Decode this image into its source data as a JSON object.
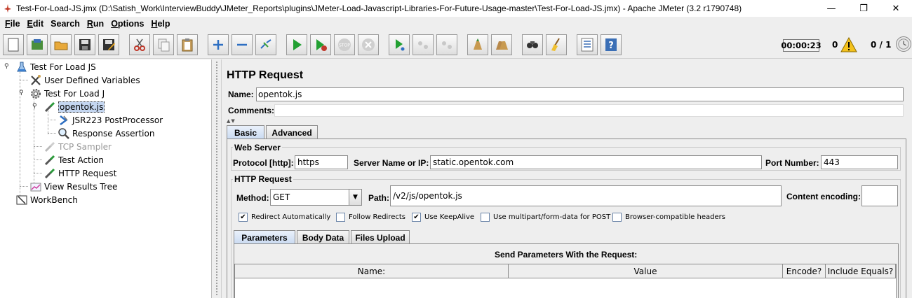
{
  "window": {
    "title": "Test-For-Load-JS.jmx (D:\\Satish_Work\\InterviewBuddy\\JMeter_Reports\\plugins\\JMeter-Load-Javascript-Libraries-For-Future-Usage-master\\Test-For-Load-JS.jmx) - Apache JMeter (3.2 r1790748)",
    "minimize": "—",
    "maximize": "❐",
    "close": "✕"
  },
  "menu": {
    "items": [
      {
        "underline": "F",
        "rest": "ile"
      },
      {
        "underline": "E",
        "rest": "dit"
      },
      {
        "underline": "",
        "rest": "Search"
      },
      {
        "underline": "R",
        "rest": "un"
      },
      {
        "underline": "O",
        "rest": "ptions"
      },
      {
        "underline": "H",
        "rest": "elp"
      }
    ]
  },
  "toolbar": {
    "buttons": [
      "new-icon",
      "templates-icon",
      "open-icon",
      "save-icon",
      "save-as-icon",
      "cut-icon",
      "copy-icon",
      "paste-icon",
      "expand-icon",
      "collapse-icon",
      "toggle-icon",
      "start-icon",
      "start-no-pauses-icon",
      "stop-icon",
      "shutdown-icon",
      "remote-start-icon",
      "remote-stop-icon",
      "remote-shutdown-icon",
      "clear-icon",
      "clear-all-icon",
      "search-icon",
      "reset-search-icon",
      "function-helper-icon",
      "help-icon"
    ],
    "timer": "00:00:23",
    "warnings": "0",
    "threads": "0 / 1"
  },
  "tree": {
    "nodes": [
      {
        "label": "Test For Load JS",
        "icon": "test-plan-icon"
      },
      {
        "label": "User Defined Variables",
        "icon": "config-icon"
      },
      {
        "label": "Test For Load J",
        "icon": "thread-group-icon"
      },
      {
        "label": "opentok.js",
        "icon": "sampler-icon"
      },
      {
        "label": "JSR223 PostProcessor",
        "icon": "postprocessor-icon"
      },
      {
        "label": "Response Assertion",
        "icon": "assertion-icon"
      },
      {
        "label": "TCP Sampler",
        "icon": "sampler-icon"
      },
      {
        "label": "Test Action",
        "icon": "sampler-icon"
      },
      {
        "label": "HTTP Request",
        "icon": "sampler-icon"
      },
      {
        "label": "View Results Tree",
        "icon": "listener-icon"
      },
      {
        "label": "WorkBench",
        "icon": "workbench-icon"
      }
    ]
  },
  "editor": {
    "title": "HTTP Request",
    "name_label": "Name:",
    "name_value": "opentok.js",
    "comments_label": "Comments:",
    "tabs": [
      "Basic",
      "Advanced"
    ],
    "web_server": {
      "title": "Web Server",
      "protocol_label": "Protocol [http]:",
      "protocol_value": "https",
      "server_label": "Server Name or IP:",
      "server_value": "static.opentok.com",
      "port_label": "Port Number:",
      "port_value": "443"
    },
    "http_request": {
      "title": "HTTP Request",
      "method_label": "Method:",
      "method_value": "GET",
      "path_label": "Path:",
      "path_value": "/v2/js/opentok.js",
      "encoding_label": "Content encoding:",
      "encoding_value": ""
    },
    "checkboxes": [
      {
        "label": "Redirect Automatically",
        "checked": true
      },
      {
        "label": "Follow Redirects",
        "checked": false
      },
      {
        "label": "Use KeepAlive",
        "checked": true
      },
      {
        "label": "Use multipart/form-data for POST",
        "checked": false
      },
      {
        "label": "Browser-compatible headers",
        "checked": false
      }
    ],
    "sub_tabs": [
      "Parameters",
      "Body Data",
      "Files Upload"
    ],
    "params_title": "Send Parameters With the Request:",
    "columns": [
      "Name:",
      "Value",
      "Encode?",
      "Include Equals?"
    ]
  }
}
